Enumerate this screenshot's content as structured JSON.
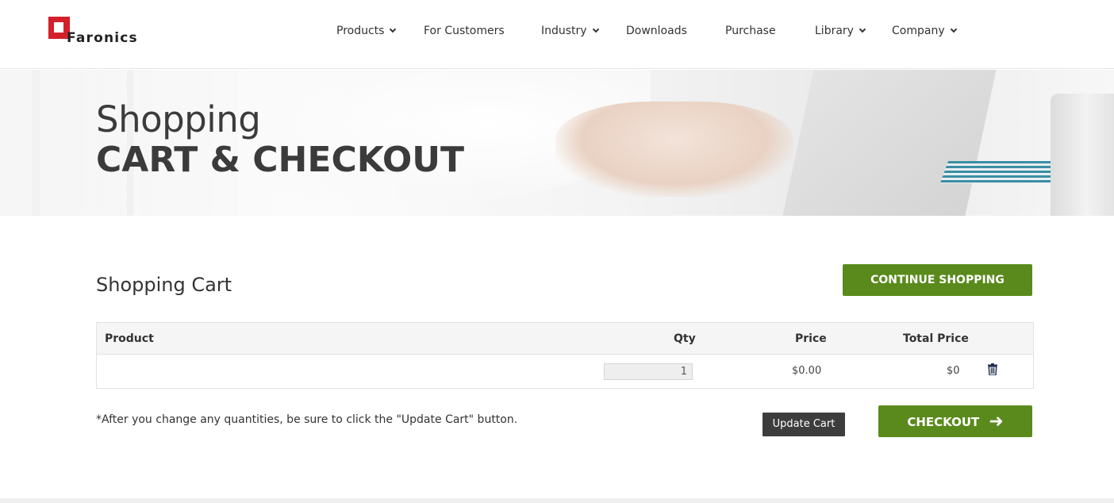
{
  "brand": {
    "name": "Faronics",
    "logo_word": "Faronics",
    "accent": "#d3202a"
  },
  "nav": {
    "items": [
      {
        "label": "Products",
        "has_dropdown": true
      },
      {
        "label": "For Customers",
        "has_dropdown": false
      },
      {
        "label": "Industry",
        "has_dropdown": true
      },
      {
        "label": "Downloads",
        "has_dropdown": false
      },
      {
        "label": "Purchase",
        "has_dropdown": false
      },
      {
        "label": "Library",
        "has_dropdown": true
      },
      {
        "label": "Company",
        "has_dropdown": true
      }
    ]
  },
  "hero": {
    "title_line1": "Shopping",
    "title_line2": "CART & CHECKOUT"
  },
  "cart": {
    "heading": "Shopping Cart",
    "continue_label": "CONTINUE SHOPPING",
    "columns": {
      "product": "Product",
      "qty": "Qty",
      "price": "Price",
      "total": "Total Price"
    },
    "rows": [
      {
        "product": "",
        "qty": "1",
        "price": "$0.00",
        "total": "$0"
      }
    ],
    "note": "*After you change any quantities, be sure to click the \"Update Cart\" button.",
    "update_label": "Update Cart",
    "checkout_label": "CHECKOUT",
    "checkout_icon": "arrow-right-icon",
    "delete_icon": "trash-icon"
  },
  "colors": {
    "green": "#5a8a1c",
    "dark_button": "#3d3d3d"
  }
}
